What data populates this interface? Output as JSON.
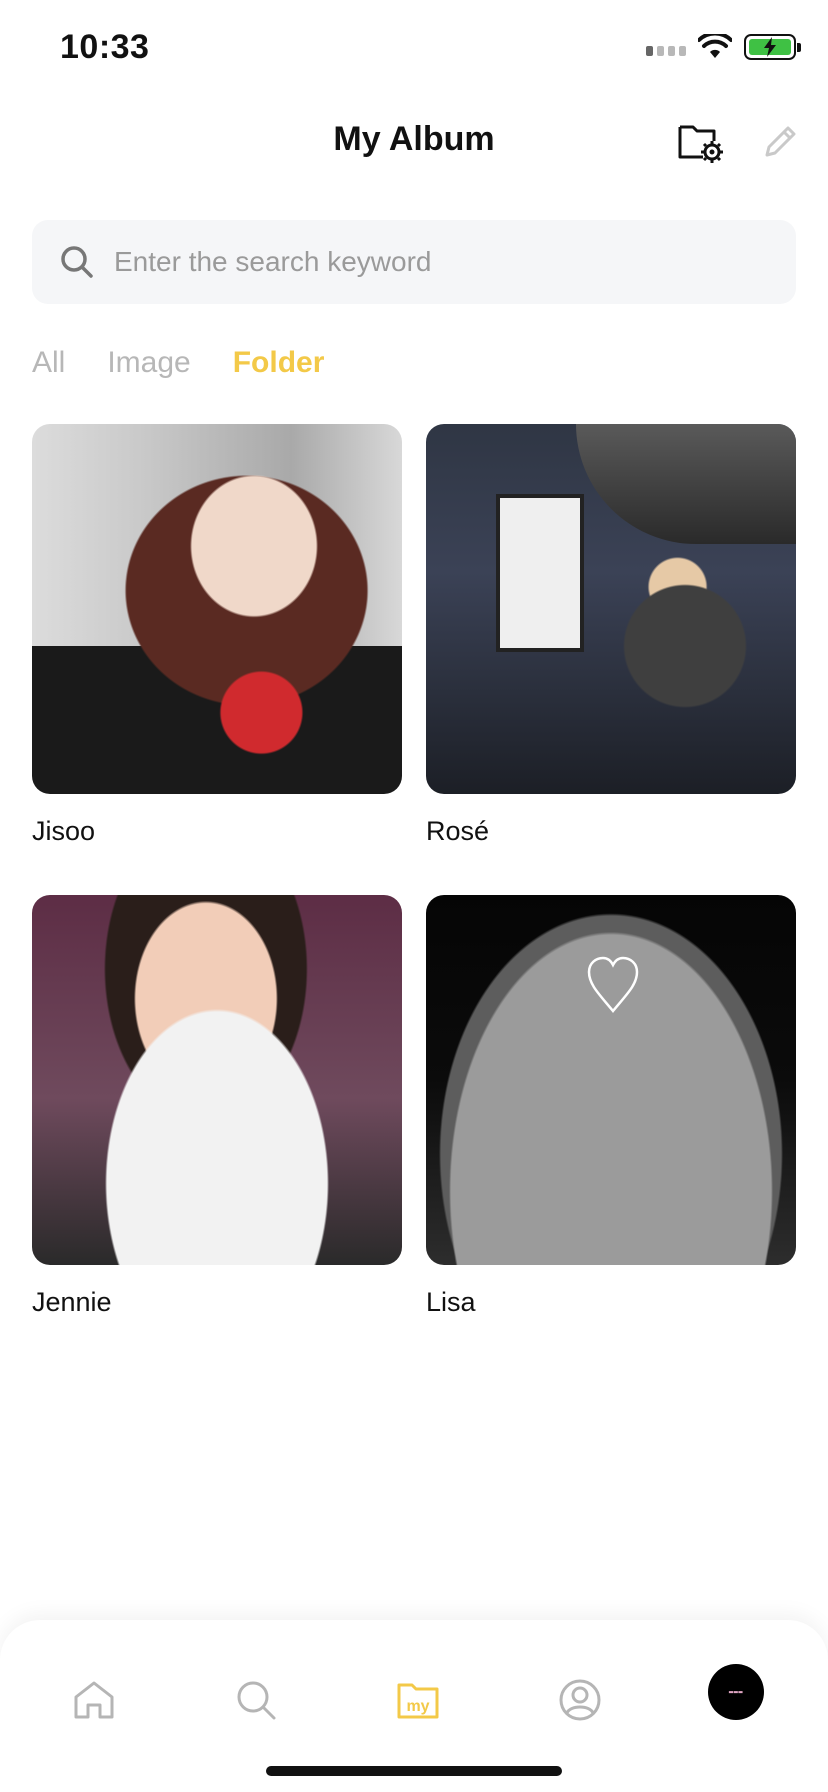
{
  "status_bar": {
    "time": "10:33"
  },
  "header": {
    "title": "My Album"
  },
  "search": {
    "placeholder": "Enter the search keyword",
    "value": ""
  },
  "tabs": [
    {
      "label": "All",
      "active": false
    },
    {
      "label": "Image",
      "active": false
    },
    {
      "label": "Folder",
      "active": true
    }
  ],
  "folders": [
    {
      "label": "Jisoo"
    },
    {
      "label": "Rosé"
    },
    {
      "label": "Jennie"
    },
    {
      "label": "Lisa"
    }
  ],
  "tab_bar": {
    "items": [
      {
        "icon": "home-icon",
        "active": false
      },
      {
        "icon": "search-icon",
        "active": false
      },
      {
        "icon": "my-folder-icon",
        "active": true,
        "text": "my"
      },
      {
        "icon": "profile-icon",
        "active": false
      },
      {
        "icon": "avatar",
        "active": false
      }
    ]
  },
  "colors": {
    "accent": "#f3c948",
    "inactive_tab": "#b7b7b7",
    "search_bg": "#f5f6f8",
    "battery": "#3fc144"
  }
}
